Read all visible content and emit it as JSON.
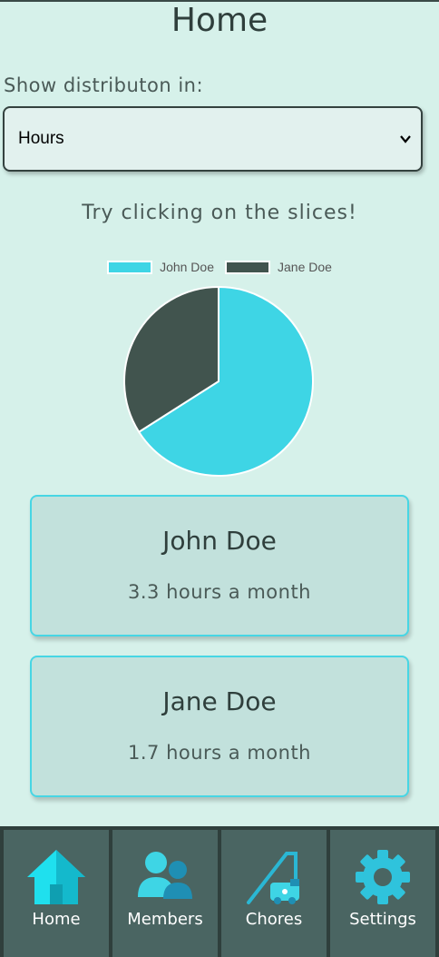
{
  "header": {
    "title": "Home"
  },
  "distribution": {
    "label": "Show distributon in:",
    "selected": "Hours"
  },
  "hint": "Try clicking on the slices!",
  "colors": {
    "john": "#3ed5e5",
    "jane": "#41544e",
    "accent": "#47d6e4"
  },
  "chart_data": {
    "type": "pie",
    "categories": [
      "John Doe",
      "Jane Doe"
    ],
    "values": [
      3.3,
      1.7
    ],
    "legend": "top"
  },
  "cards": [
    {
      "name": "John Doe",
      "value": "3.3 hours a month"
    },
    {
      "name": "Jane Doe",
      "value": "1.7 hours a month"
    }
  ],
  "nav": [
    {
      "label": "Home",
      "icon": "home-icon"
    },
    {
      "label": "Members",
      "icon": "members-icon"
    },
    {
      "label": "Chores",
      "icon": "vacuum-icon"
    },
    {
      "label": "Settings",
      "icon": "gear-icon"
    }
  ]
}
